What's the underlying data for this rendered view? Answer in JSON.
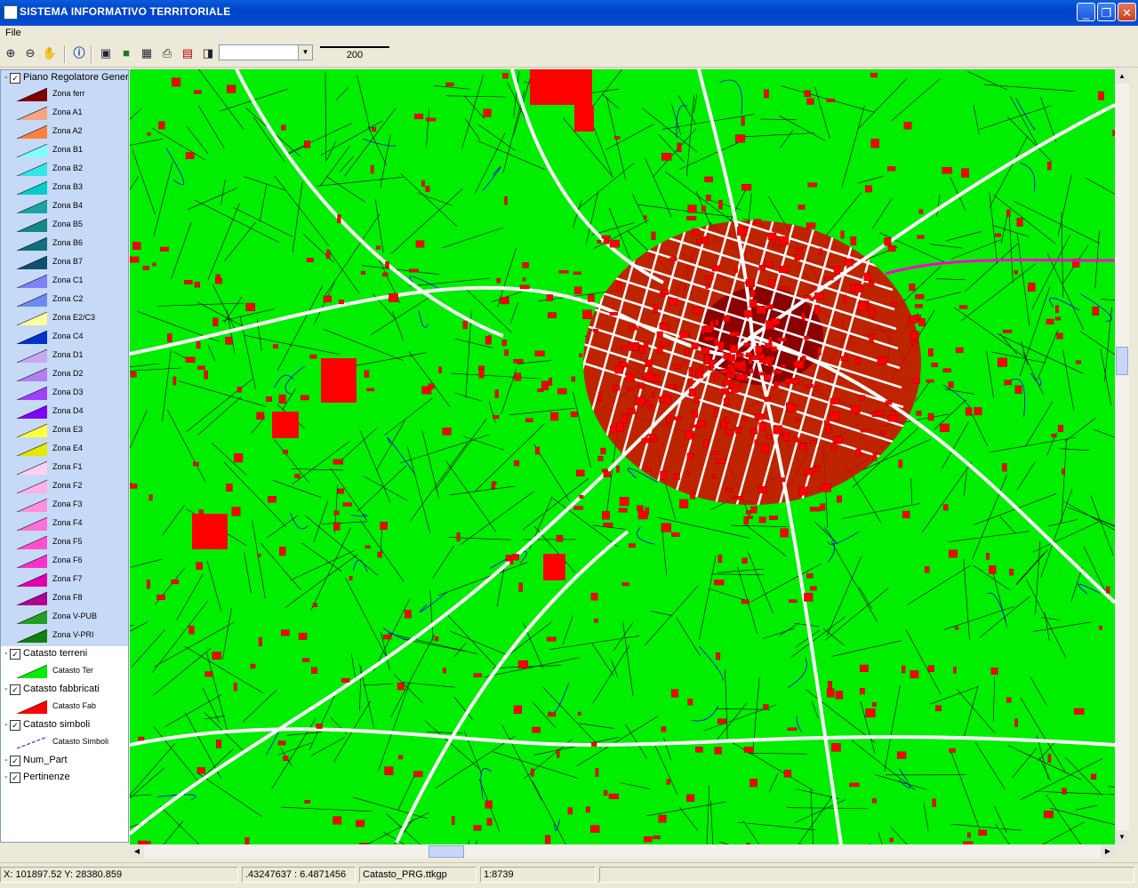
{
  "window": {
    "title": "SISTEMA INFORMATIVO TERRITORIALE"
  },
  "menu": {
    "file": "File"
  },
  "toolbar": {
    "buttons": [
      "zoom-in-icon",
      "zoom-out-icon",
      "pan-hand-icon",
      "info-icon",
      "map-view-icon",
      "layer-icon",
      "grid-icon",
      "print-icon",
      "layer-select-icon",
      "export-icon"
    ],
    "combo_value": "",
    "scale_label": "200"
  },
  "legend": {
    "prg_group": "Piano Regolatore Genera",
    "prg_items": [
      {
        "label": "Zona ferr",
        "color": "#800000"
      },
      {
        "label": "Zona A1",
        "color": "#F4A583"
      },
      {
        "label": "Zona A2",
        "color": "#FF8040"
      },
      {
        "label": "Zona B1",
        "color": "#80FFFF"
      },
      {
        "label": "Zona B2",
        "color": "#33E6E6"
      },
      {
        "label": "Zona B3",
        "color": "#00CCCC"
      },
      {
        "label": "Zona B4",
        "color": "#1AA3A3"
      },
      {
        "label": "Zona B5",
        "color": "#138888"
      },
      {
        "label": "Zona B6",
        "color": "#106E80"
      },
      {
        "label": "Zona B7",
        "color": "#0C5270"
      },
      {
        "label": "Zona C1",
        "color": "#8080FF"
      },
      {
        "label": "Zona C2",
        "color": "#6A8CF0"
      },
      {
        "label": "Zona E2/C3",
        "color": "#FFFF99"
      },
      {
        "label": "Zona C4",
        "color": "#0033CC"
      },
      {
        "label": "Zona D1",
        "color": "#C8A8F0"
      },
      {
        "label": "Zona D2",
        "color": "#B080F0"
      },
      {
        "label": "Zona D3",
        "color": "#A040FF"
      },
      {
        "label": "Zona D4",
        "color": "#8000FF"
      },
      {
        "label": "Zona E3",
        "color": "#FFFF40"
      },
      {
        "label": "Zona E4",
        "color": "#E6E600"
      },
      {
        "label": "Zona F1",
        "color": "#FFD0F0"
      },
      {
        "label": "Zona F2",
        "color": "#FFB0E8"
      },
      {
        "label": "Zona F3",
        "color": "#FF90E0"
      },
      {
        "label": "Zona F4",
        "color": "#FF70D8"
      },
      {
        "label": "Zona F5",
        "color": "#FF50D0"
      },
      {
        "label": "Zona F6",
        "color": "#FF30C8"
      },
      {
        "label": "Zona F7",
        "color": "#E000B0"
      },
      {
        "label": "Zona F8",
        "color": "#B00090"
      },
      {
        "label": "Zona V-PUB",
        "color": "#20A020"
      },
      {
        "label": "Zona V-PRI",
        "color": "#108010"
      }
    ],
    "layers": [
      {
        "group": "Catasto terreni",
        "item": "Catasto Ter",
        "color": "#00EE00"
      },
      {
        "group": "Catasto fabbricati",
        "item": "Catasto Fab",
        "color": "#FF0000"
      },
      {
        "group": "Catasto simboli",
        "item": "Catasto Simboli",
        "color": "#2040C0"
      },
      {
        "group": "Num_Part",
        "item": "",
        "color": ""
      },
      {
        "group": "Pertinenze",
        "item": "",
        "color": ""
      }
    ]
  },
  "status": {
    "coords": "X: 101897.52 Y: 28380.859",
    "latlon": ".43247637 :  6.4871456",
    "project": "Catasto_PRG.ttkgp",
    "scale": "1:8739"
  },
  "colors": {
    "map_land": "#00EE00",
    "buildings": "#FF0000",
    "roads": "#FFFFFF",
    "parcels": "#000000",
    "water": "#0000FF"
  }
}
